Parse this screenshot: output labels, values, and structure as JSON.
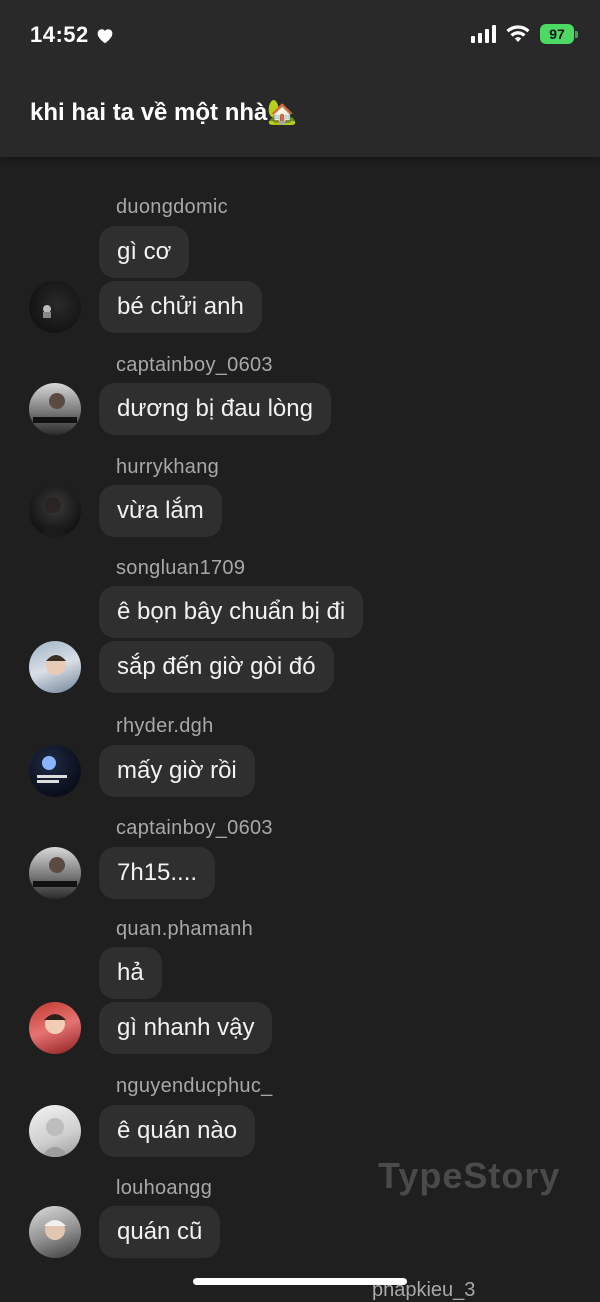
{
  "status_bar": {
    "time": "14:52",
    "battery": "97"
  },
  "header": {
    "title": "khi hai ta về một nhà🏡"
  },
  "messages": [
    {
      "user": "duongdomic",
      "bubbles": [
        "gì cơ",
        "bé chửi anh"
      ]
    },
    {
      "user": "captainboy_0603",
      "bubbles": [
        "dương bị đau lòng"
      ]
    },
    {
      "user": "hurrykhang",
      "bubbles": [
        "vừa lắm"
      ]
    },
    {
      "user": "songluan1709",
      "bubbles": [
        "ê bọn bây chuẩn bị đi",
        "sắp đến giờ gòi đó"
      ]
    },
    {
      "user": "rhyder.dgh",
      "bubbles": [
        "mấy giờ rồi"
      ]
    },
    {
      "user": "captainboy_0603",
      "bubbles": [
        "7h15...."
      ]
    },
    {
      "user": "quan.phamanh",
      "bubbles": [
        "hả",
        "gì nhanh vậy"
      ]
    },
    {
      "user": "nguyenducphuc_",
      "bubbles": [
        "ê quán nào"
      ]
    },
    {
      "user": "louhoangg",
      "bubbles": [
        "quán cũ"
      ]
    }
  ],
  "next_user": "phapkieu_3",
  "watermark": "TypeStory",
  "colors": {
    "background": "#1f1f1f",
    "header": "#292929",
    "bubble": "#2f2f2f",
    "battery": "#4cd964"
  }
}
